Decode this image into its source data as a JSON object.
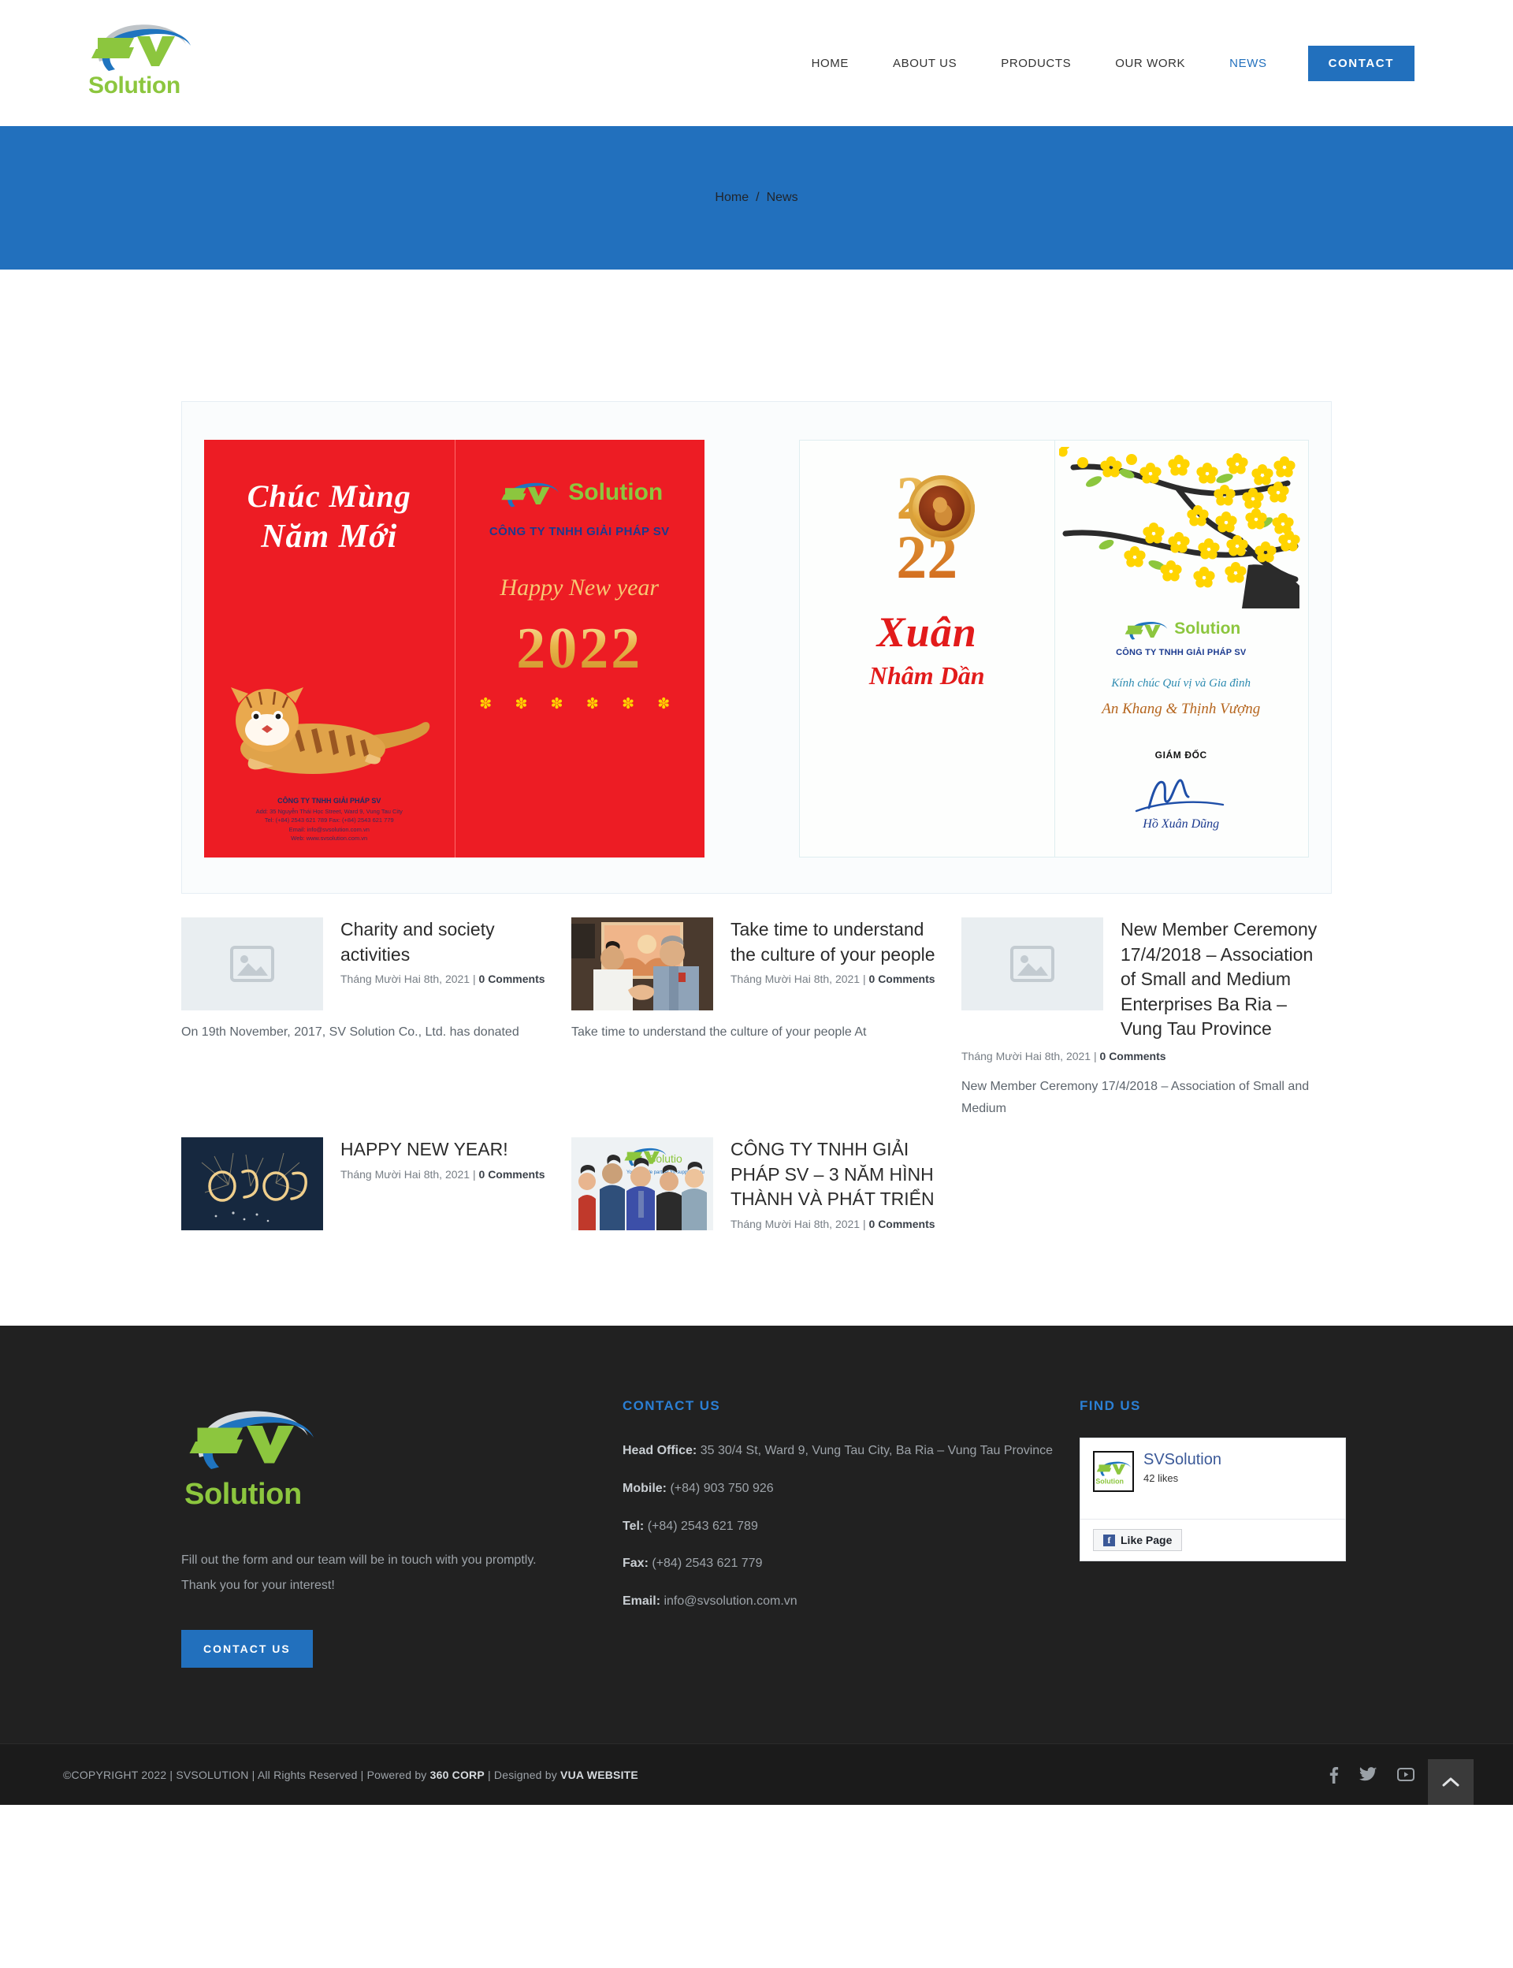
{
  "brand": {
    "name": "SV",
    "word": "Solution"
  },
  "nav": {
    "items": [
      {
        "label": "HOME",
        "active": false
      },
      {
        "label": "ABOUT US",
        "active": false
      },
      {
        "label": "PRODUCTS",
        "active": false
      },
      {
        "label": "OUR WORK",
        "active": false
      },
      {
        "label": "NEWS",
        "active": true
      }
    ],
    "cta": "CONTACT"
  },
  "breadcrumb": {
    "home": "Home",
    "separator": "/",
    "current": "News"
  },
  "featured": {
    "red_card": {
      "greeting_line1": "Chúc Mùng",
      "greeting_line2": "Năm Mới",
      "logo_word": "Solution",
      "company": "CÔNG TY TNHH GIẢI PHÁP SV",
      "happy_new_year": "Happy New year",
      "year": "2022",
      "flowers": "✽ ✽ ✽ ✽ ✽ ✽",
      "address_line1": "CÔNG TY TNHH GIẢI PHÁP SV",
      "address_line2": "Add: 35 Nguyễn Thái Học Street, Ward 9, Vung Tau City",
      "address_line3": "Tel: (+84) 2543 621 789   Fax: (+84) 2543 621 779",
      "address_line4": "Email: info@svsolution.com.vn",
      "address_line5": "Web: www.svsolution.com.vn"
    },
    "white_card": {
      "year_top": "20",
      "year_bottom": "22",
      "xuan": "Xuân",
      "nham_dan": "Nhâm Dần",
      "logo_word": "Solution",
      "company": "CÔNG TY TNHH GIẢI PHÁP SV",
      "wish_line1": "Kính chúc Quí vị và Gia đình",
      "wish_line2": "An Khang & Thịnh Vượng",
      "director_label": "GIÁM ĐỐC",
      "director_name": "Hồ Xuân Dũng"
    }
  },
  "posts": [
    {
      "title": "Charity and society activities",
      "date": "Tháng Mười Hai 8th, 2021",
      "comments": "0 Comments",
      "excerpt": "On 19th November, 2017, SV Solution Co., Ltd. has donated",
      "thumb": "placeholder"
    },
    {
      "title": "Take time to understand the culture of your people",
      "date": "Tháng Mười Hai 8th, 2021",
      "comments": "0 Comments",
      "excerpt": "Take time to understand the culture of your people At",
      "thumb": "handshake-photo"
    },
    {
      "title": "New Member Ceremony 17/4/2018 – Association of Small and Medium Enterprises Ba Ria – Vung Tau Province",
      "date": "Tháng Mười Hai 8th, 2021",
      "comments": "0 Comments",
      "excerpt": "New Member Ceremony 17/4/2018 – Association of Small and Medium",
      "thumb": "placeholder"
    },
    {
      "title": "HAPPY NEW YEAR!",
      "date": "Tháng Mười Hai 8th, 2021",
      "comments": "0 Comments",
      "excerpt": "",
      "thumb": "fireworks-photo"
    },
    {
      "title": "CÔNG TY TNHH GIẢI PHÁP SV – 3 NĂM HÌNH THÀNH VÀ PHÁT TRIỂN",
      "date": "Tháng Mười Hai 8th, 2021",
      "comments": "0 Comments",
      "excerpt": "",
      "thumb": "team-photo"
    }
  ],
  "footer": {
    "about_text": "Fill out the form and our team will be in touch with you promptly. Thank you for your interest!",
    "contact_button": "CONTACT US",
    "contact_heading": "CONTACT US",
    "contact": {
      "head_office_label": "Head Office:",
      "head_office_value": "35 30/4 St, Ward 9, Vung Tau City, Ba Ria – Vung Tau Province",
      "mobile_label": "Mobile:",
      "mobile_value": "(+84) 903 750 926",
      "tel_label": "Tel:",
      "tel_value": "(+84) 2543 621 789",
      "fax_label": "Fax:",
      "fax_value": "(+84) 2543 621 779",
      "email_label": "Email:",
      "email_value": "info@svsolution.com.vn"
    },
    "find_us_heading": "FIND US",
    "facebook": {
      "page_name": "SVSolution",
      "likes": "42 likes",
      "like_button": "Like Page"
    }
  },
  "copyright": {
    "prefix": "©COPYRIGHT 2022 | SVSOLUTION | All Rights Reserved | Powered by ",
    "powered_by": "360 CORP",
    "middle": " | Designed by ",
    "designer": "VUA WEBSITE"
  },
  "colors": {
    "brand_blue": "#2270bd",
    "brand_green": "#8cc63e",
    "footer_bg": "#212121",
    "red": "#ed1c24"
  }
}
